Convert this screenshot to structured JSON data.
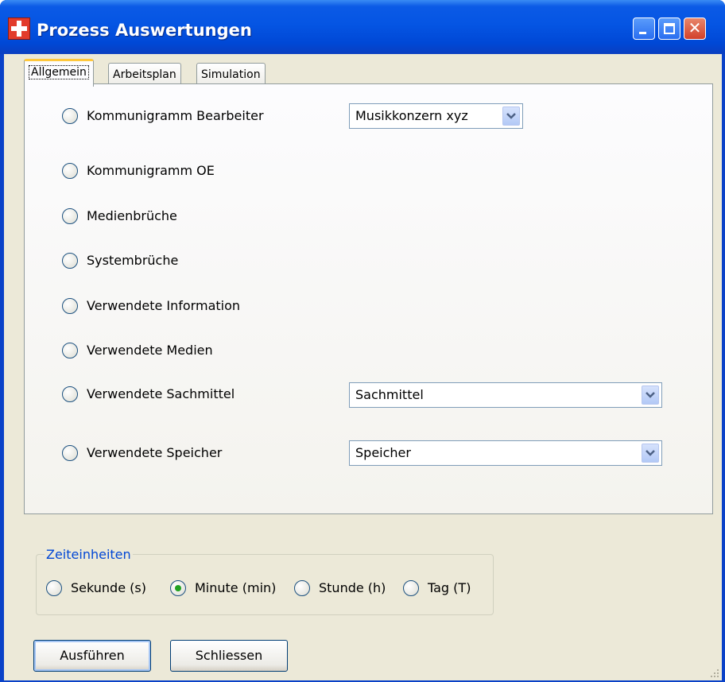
{
  "window": {
    "title": "Prozess Auswertungen"
  },
  "tabs": [
    {
      "label": "Allgemein",
      "active": true
    },
    {
      "label": "Arbeitsplan",
      "active": false
    },
    {
      "label": "Simulation",
      "active": false
    }
  ],
  "options": [
    {
      "label": "Kommunigramm Bearbeiter",
      "checked": false,
      "select": "Musikkonzern xyz"
    },
    {
      "label": "Kommunigramm OE",
      "checked": false
    },
    {
      "label": "Medienbrüche",
      "checked": false
    },
    {
      "label": "Systembrüche",
      "checked": false
    },
    {
      "label": "Verwendete Information",
      "checked": false
    },
    {
      "label": "Verwendete Medien",
      "checked": false
    },
    {
      "label": "Verwendete Sachmittel",
      "checked": false,
      "select": "Sachmittel"
    },
    {
      "label": "Verwendete Speicher",
      "checked": false,
      "select": "Speicher"
    }
  ],
  "time_units": {
    "legend": "Zeiteinheiten",
    "items": [
      {
        "label": "Sekunde (s)",
        "checked": false
      },
      {
        "label": "Minute (min)",
        "checked": true
      },
      {
        "label": "Stunde (h)",
        "checked": false
      },
      {
        "label": "Tag (T)",
        "checked": false
      }
    ]
  },
  "buttons": {
    "run": "Ausführen",
    "close": "Schliessen"
  },
  "colors": {
    "titlebar": "#0555e3",
    "accent": "#0046d5",
    "tab_highlight": "#ffc83c",
    "radio_dot": "#21a121"
  }
}
